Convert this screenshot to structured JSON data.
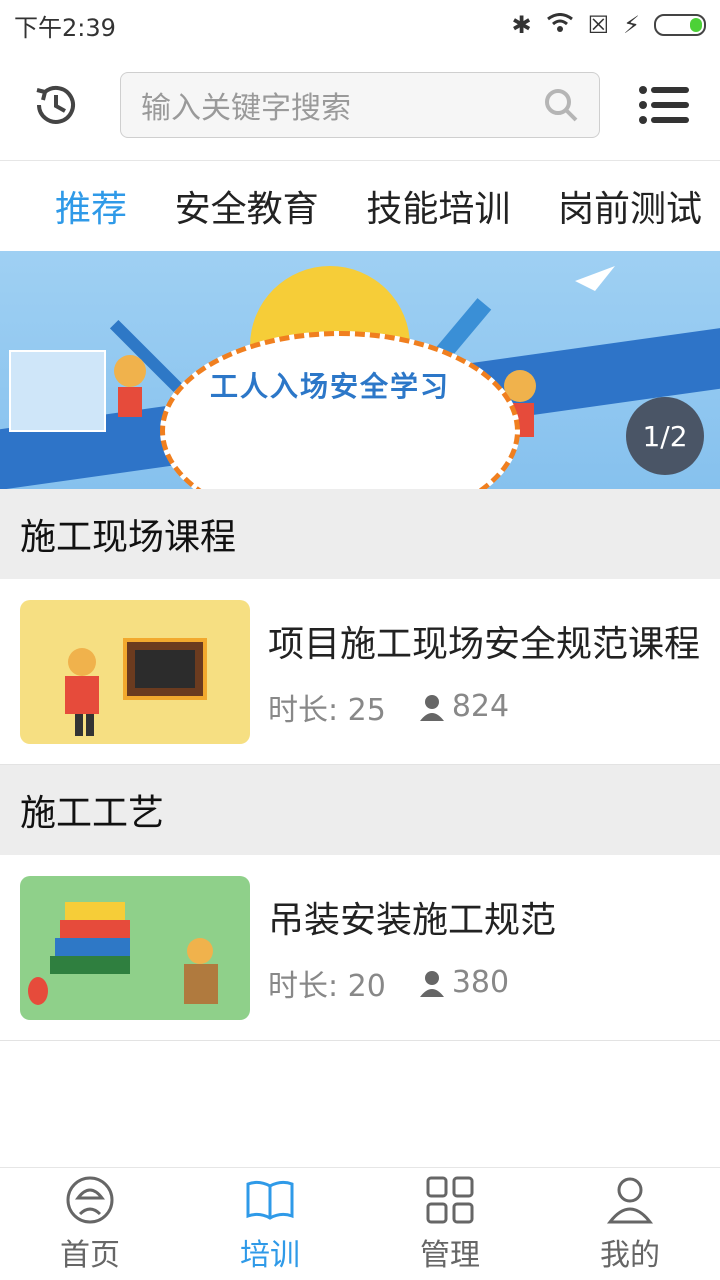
{
  "status_bar": {
    "time": "下午2:39"
  },
  "header": {
    "search_placeholder": "输入关键字搜索"
  },
  "tabs": [
    {
      "label": "推荐"
    },
    {
      "label": "安全教育"
    },
    {
      "label": "技能培训"
    },
    {
      "label": "岗前测试"
    }
  ],
  "banner": {
    "title": "工人入场安全学习",
    "pager": "1/2"
  },
  "sections": [
    {
      "title": "施工现场课程",
      "items": [
        {
          "title": "项目施工现场安全规范课程",
          "duration_label": "时长:",
          "duration": "25",
          "views": "824"
        }
      ]
    },
    {
      "title": "施工工艺",
      "items": [
        {
          "title": "吊装安装施工规范",
          "duration_label": "时长:",
          "duration": "20",
          "views": "380"
        }
      ]
    }
  ],
  "bottom_nav": [
    {
      "label": "首页",
      "icon": "home-helmet-icon"
    },
    {
      "label": "培训",
      "icon": "book-icon"
    },
    {
      "label": "管理",
      "icon": "grid-icon"
    },
    {
      "label": "我的",
      "icon": "user-icon"
    }
  ],
  "colors": {
    "accent": "#2f9ae8",
    "section_bg": "#ededed"
  }
}
